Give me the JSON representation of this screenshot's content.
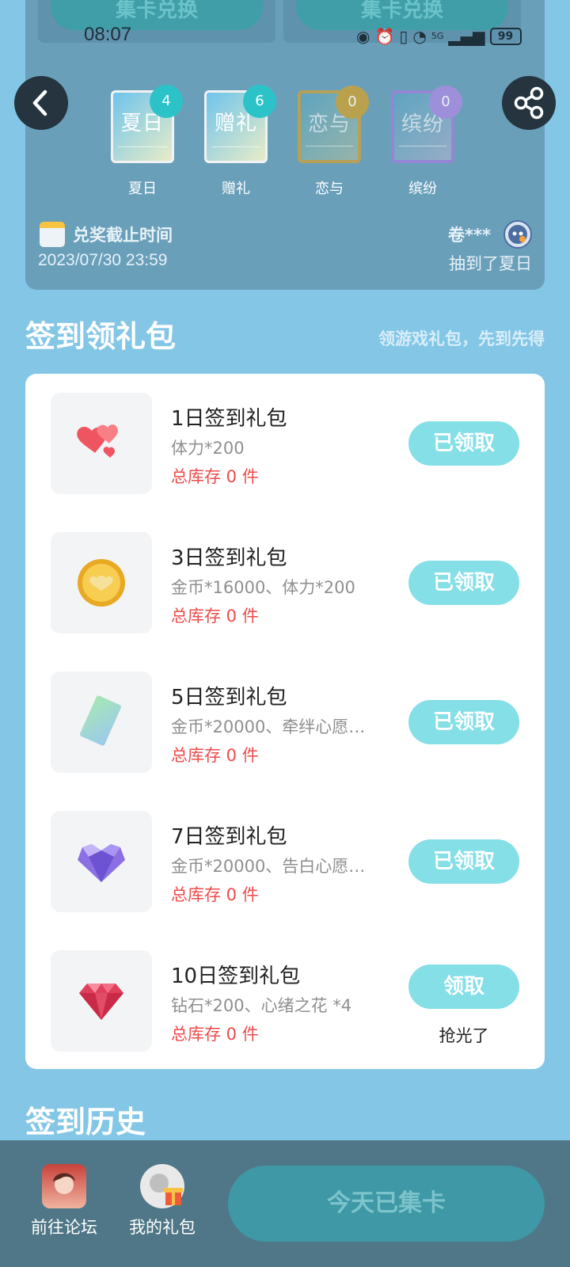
{
  "exchange": {
    "left_label": "集卡兑换",
    "right_label": "集卡兑换"
  },
  "status_bar": {
    "time": "08:07",
    "battery": "99",
    "network": "5G"
  },
  "cards": [
    {
      "char": "夏日",
      "count": "4",
      "name": "夏日",
      "badge_color": "#2bc3c8"
    },
    {
      "char": "赠礼",
      "count": "6",
      "name": "赠礼",
      "badge_color": "#2bc3c8"
    },
    {
      "char": "恋与",
      "count": "0",
      "name": "恋与",
      "badge_color": "#c8a23a"
    },
    {
      "char": "缤纷",
      "count": "0",
      "name": "缤纷",
      "badge_color": "#a88de0"
    }
  ],
  "deadline": {
    "label": "兑奖截止时间",
    "value": "2023/07/30 23:59"
  },
  "winner": {
    "name": "卷***",
    "result": "抽到了夏日"
  },
  "signin": {
    "title": "签到领礼包",
    "hint": "领游戏礼包，先到先得"
  },
  "gifts": [
    {
      "title": "1日签到礼包",
      "content": "体力*200",
      "stock": "总库存 0 件",
      "button": "已领取",
      "icon": "hearts-icon"
    },
    {
      "title": "3日签到礼包",
      "content": "金币*16000、体力*200",
      "stock": "总库存 0 件",
      "button": "已领取",
      "icon": "gold-coin-icon"
    },
    {
      "title": "5日签到礼包",
      "content": "金币*20000、牵绊心愿…",
      "stock": "总库存 0 件",
      "button": "已领取",
      "icon": "card-ticket-icon"
    },
    {
      "title": "7日签到礼包",
      "content": "金币*20000、告白心愿…",
      "stock": "总库存 0 件",
      "button": "已领取",
      "icon": "purple-heart-gem-icon"
    },
    {
      "title": "10日签到礼包",
      "content": "钻石*200、心绪之花 *4",
      "stock": "总库存 0 件",
      "button": "领取",
      "status": "抢光了",
      "icon": "diamond-icon"
    }
  ],
  "history": {
    "title": "签到历史"
  },
  "bottom_nav": {
    "forum": "前往论坛",
    "gifts": "我的礼包",
    "main_button": "今天已集卡"
  }
}
